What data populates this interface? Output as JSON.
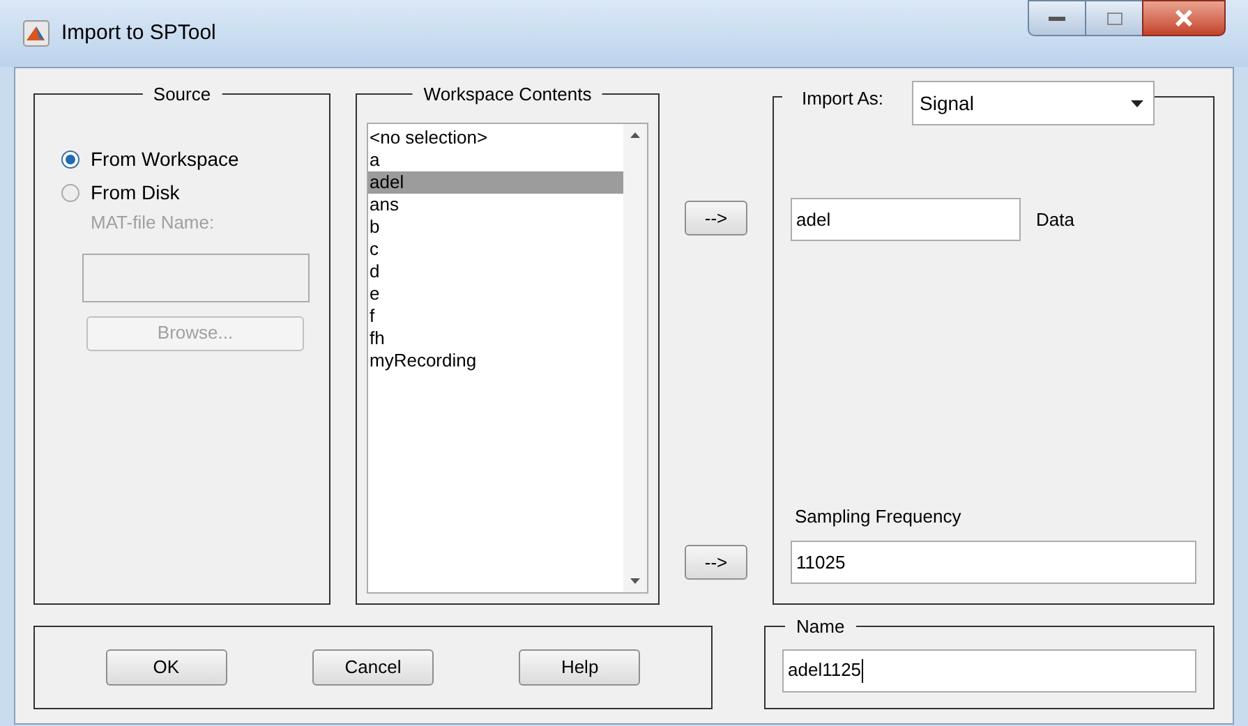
{
  "window": {
    "title": "Import to SPTool"
  },
  "source": {
    "title": "Source",
    "options": [
      {
        "label": "From Workspace",
        "selected": true
      },
      {
        "label": "From Disk",
        "selected": false
      }
    ],
    "mat_file_label": "MAT-file Name:",
    "mat_file_disabled": true,
    "browse_button": {
      "label": "Browse...",
      "disabled": true
    }
  },
  "workspace": {
    "title": "Workspace Contents",
    "items": [
      {
        "label": "<no selection>",
        "selected": false
      },
      {
        "label": "a",
        "selected": false
      },
      {
        "label": "adel",
        "selected": true
      },
      {
        "label": "ans",
        "selected": false
      },
      {
        "label": "b",
        "selected": false
      },
      {
        "label": "c",
        "selected": false
      },
      {
        "label": "d",
        "selected": false
      },
      {
        "label": "e",
        "selected": false
      },
      {
        "label": "f",
        "selected": false
      },
      {
        "label": "fh",
        "selected": false
      },
      {
        "label": "myRecording",
        "selected": false
      }
    ]
  },
  "transfer_buttons": [
    "-->",
    "-->"
  ],
  "import": {
    "label": "Import As:",
    "value": "Signal",
    "data_value": "adel",
    "data_label": "Data",
    "sampling_label": "Sampling Frequency",
    "sampling_value": "11025"
  },
  "buttons": [
    "OK",
    "Cancel",
    "Help"
  ],
  "name": {
    "title": "Name",
    "value": "adel1125"
  }
}
